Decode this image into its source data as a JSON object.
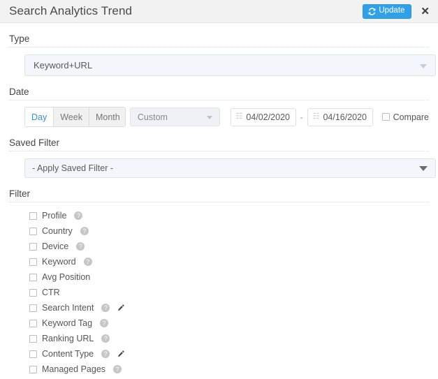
{
  "header": {
    "title": "Search Analytics Trend",
    "update_label": "Update",
    "update_icon": "refresh-icon",
    "close_label": "✕",
    "accent_color": "#30a0e8"
  },
  "type_section": {
    "label": "Type",
    "selected": "Keyword+URL"
  },
  "date_section": {
    "label": "Date",
    "granularity": [
      {
        "label": "Day",
        "active": true
      },
      {
        "label": "Week",
        "active": false
      },
      {
        "label": "Month",
        "active": false
      }
    ],
    "range_preset": "Custom",
    "start_date": "04/02/2020",
    "end_date": "04/16/2020",
    "separator": "-",
    "calendar_icon": "☷",
    "compare_label": "Compare",
    "compare_checked": false
  },
  "saved_filter_section": {
    "label": "Saved Filter",
    "selected": "- Apply Saved Filter -"
  },
  "filter_section": {
    "label": "Filter",
    "items": [
      {
        "label": "Profile",
        "help": true,
        "edit": false
      },
      {
        "label": "Country",
        "help": true,
        "edit": false
      },
      {
        "label": "Device",
        "help": true,
        "edit": false
      },
      {
        "label": "Keyword",
        "help": true,
        "edit": false
      },
      {
        "label": "Avg Position",
        "help": false,
        "edit": false
      },
      {
        "label": "CTR",
        "help": false,
        "edit": false
      },
      {
        "label": "Search Intent",
        "help": true,
        "edit": true
      },
      {
        "label": "Keyword Tag",
        "help": true,
        "edit": false
      },
      {
        "label": "Ranking URL",
        "help": true,
        "edit": false
      },
      {
        "label": "Content Type",
        "help": true,
        "edit": true
      },
      {
        "label": "Managed Pages",
        "help": true,
        "edit": false
      }
    ],
    "help_glyph": "?"
  }
}
